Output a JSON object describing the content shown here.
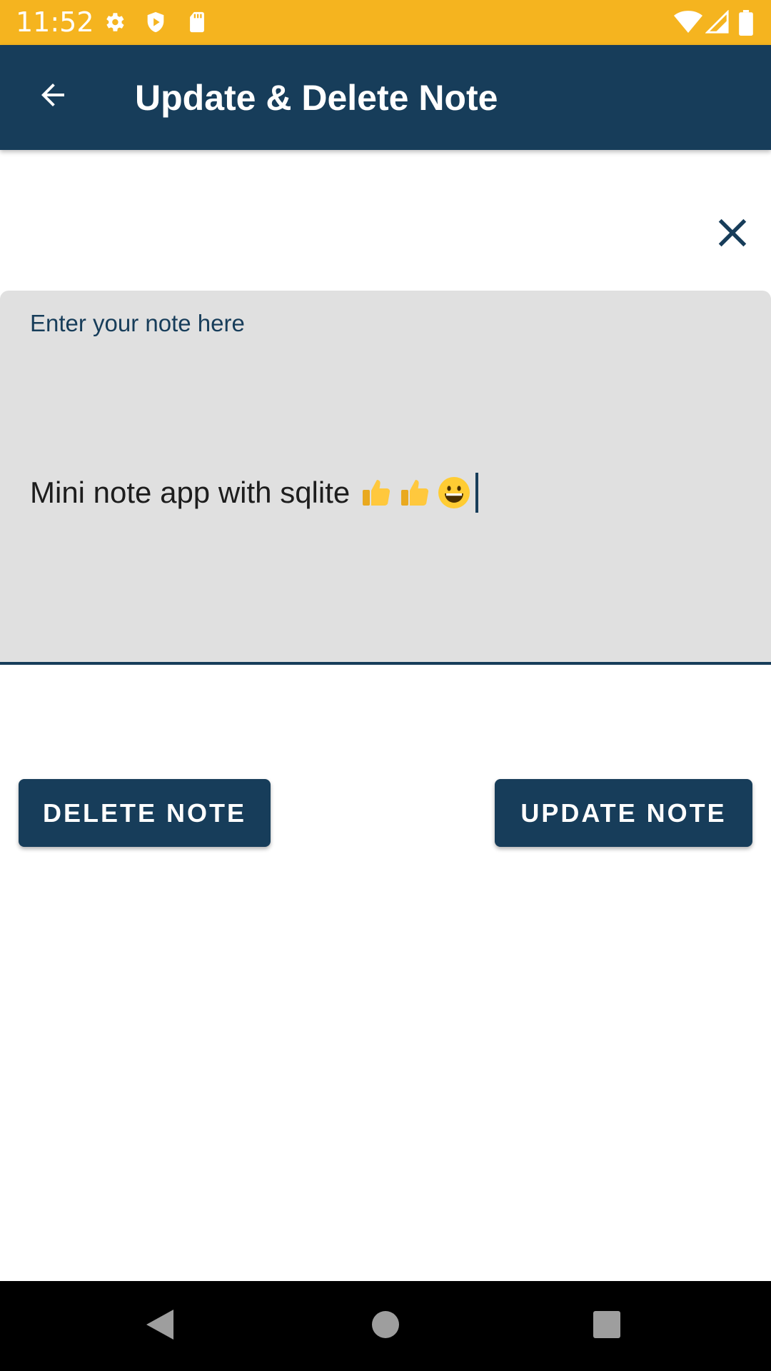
{
  "status_bar": {
    "time": "11:52",
    "left_icons": [
      "gear-icon",
      "shield-play-icon",
      "sd-card-icon"
    ],
    "right_icons": [
      "wifi-icon",
      "cell-signal-icon",
      "battery-icon"
    ],
    "color": "#F5B41F"
  },
  "app_bar": {
    "title": "Update & Delete Note",
    "back_icon": "arrow-back-icon",
    "color": "#173D5A"
  },
  "close": {
    "icon": "close-icon"
  },
  "note": {
    "label": "Enter your note here",
    "value": "Mini note app with sqlite",
    "emojis": [
      "thumbs-up-icon",
      "thumbs-up-icon",
      "grinning-face-icon"
    ]
  },
  "buttons": {
    "delete_label": "DELETE NOTE",
    "update_label": "UPDATE NOTE"
  },
  "nav_bar": {
    "icons": [
      "back-triangle-icon",
      "home-circle-icon",
      "recents-square-icon"
    ]
  }
}
